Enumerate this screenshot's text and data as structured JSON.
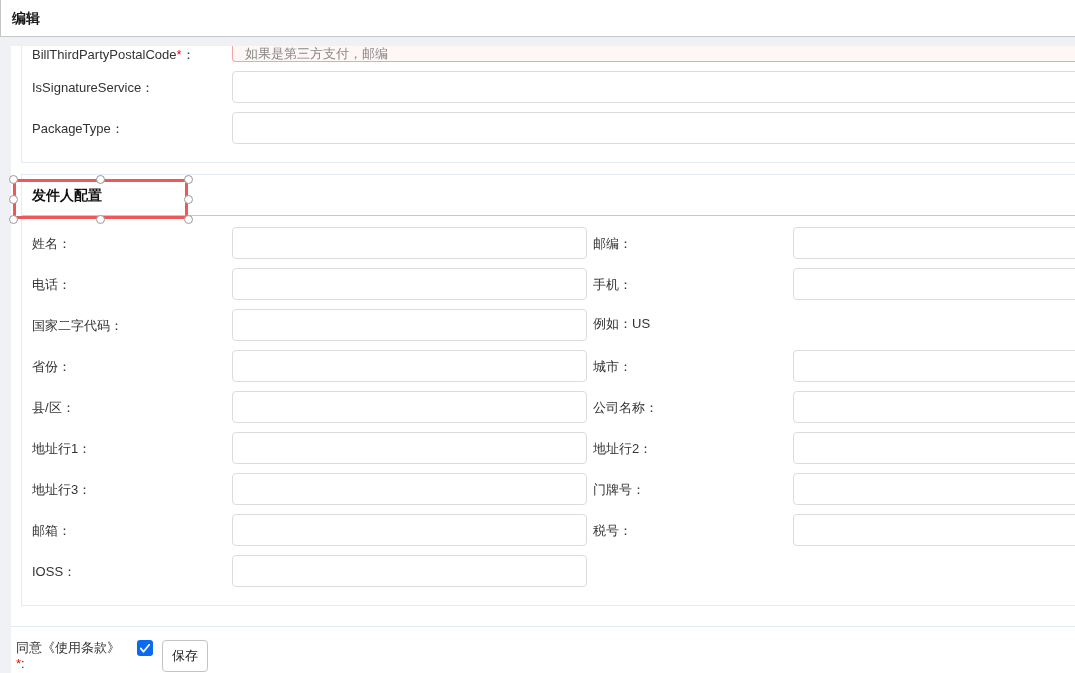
{
  "window": {
    "title": "编辑"
  },
  "section_1": {
    "fields": [
      {
        "label": "BillThirdPartyPostalCode",
        "required_mark": "*",
        "colon": "：",
        "placeholder": "如果是第三方支付，邮编",
        "invalid": true
      },
      {
        "label": "IsSignatureService：",
        "invalid": false
      },
      {
        "label": "PackageType：",
        "invalid": false
      }
    ]
  },
  "section_2": {
    "title": "发件人配置",
    "selected": true,
    "rows": [
      {
        "left": {
          "kind": "input",
          "label": "姓名："
        },
        "right": {
          "kind": "input",
          "label": "邮编："
        }
      },
      {
        "left": {
          "kind": "input",
          "label": "电话："
        },
        "right": {
          "kind": "input",
          "label": "手机："
        }
      },
      {
        "left": {
          "kind": "input",
          "label": "国家二字代码："
        },
        "right": {
          "kind": "hint",
          "text": "例如：US"
        }
      },
      {
        "left": {
          "kind": "input",
          "label": "省份："
        },
        "right": {
          "kind": "input",
          "label": "城市："
        }
      },
      {
        "left": {
          "kind": "input",
          "label": "县/区："
        },
        "right": {
          "kind": "input",
          "label": "公司名称："
        }
      },
      {
        "left": {
          "kind": "input",
          "label": "地址行1："
        },
        "right": {
          "kind": "input",
          "label": "地址行2："
        }
      },
      {
        "left": {
          "kind": "input",
          "label": "地址行3："
        },
        "right": {
          "kind": "input",
          "label": "门牌号："
        }
      },
      {
        "left": {
          "kind": "input",
          "label": "邮箱："
        },
        "right": {
          "kind": "input",
          "label": "税号："
        }
      },
      {
        "left": {
          "kind": "input",
          "label": "IOSS："
        }
      }
    ]
  },
  "footer": {
    "agree_label": "同意《使用条款》",
    "required_mark": "*",
    "colon": ":",
    "checked": true,
    "save_button": "保存"
  }
}
